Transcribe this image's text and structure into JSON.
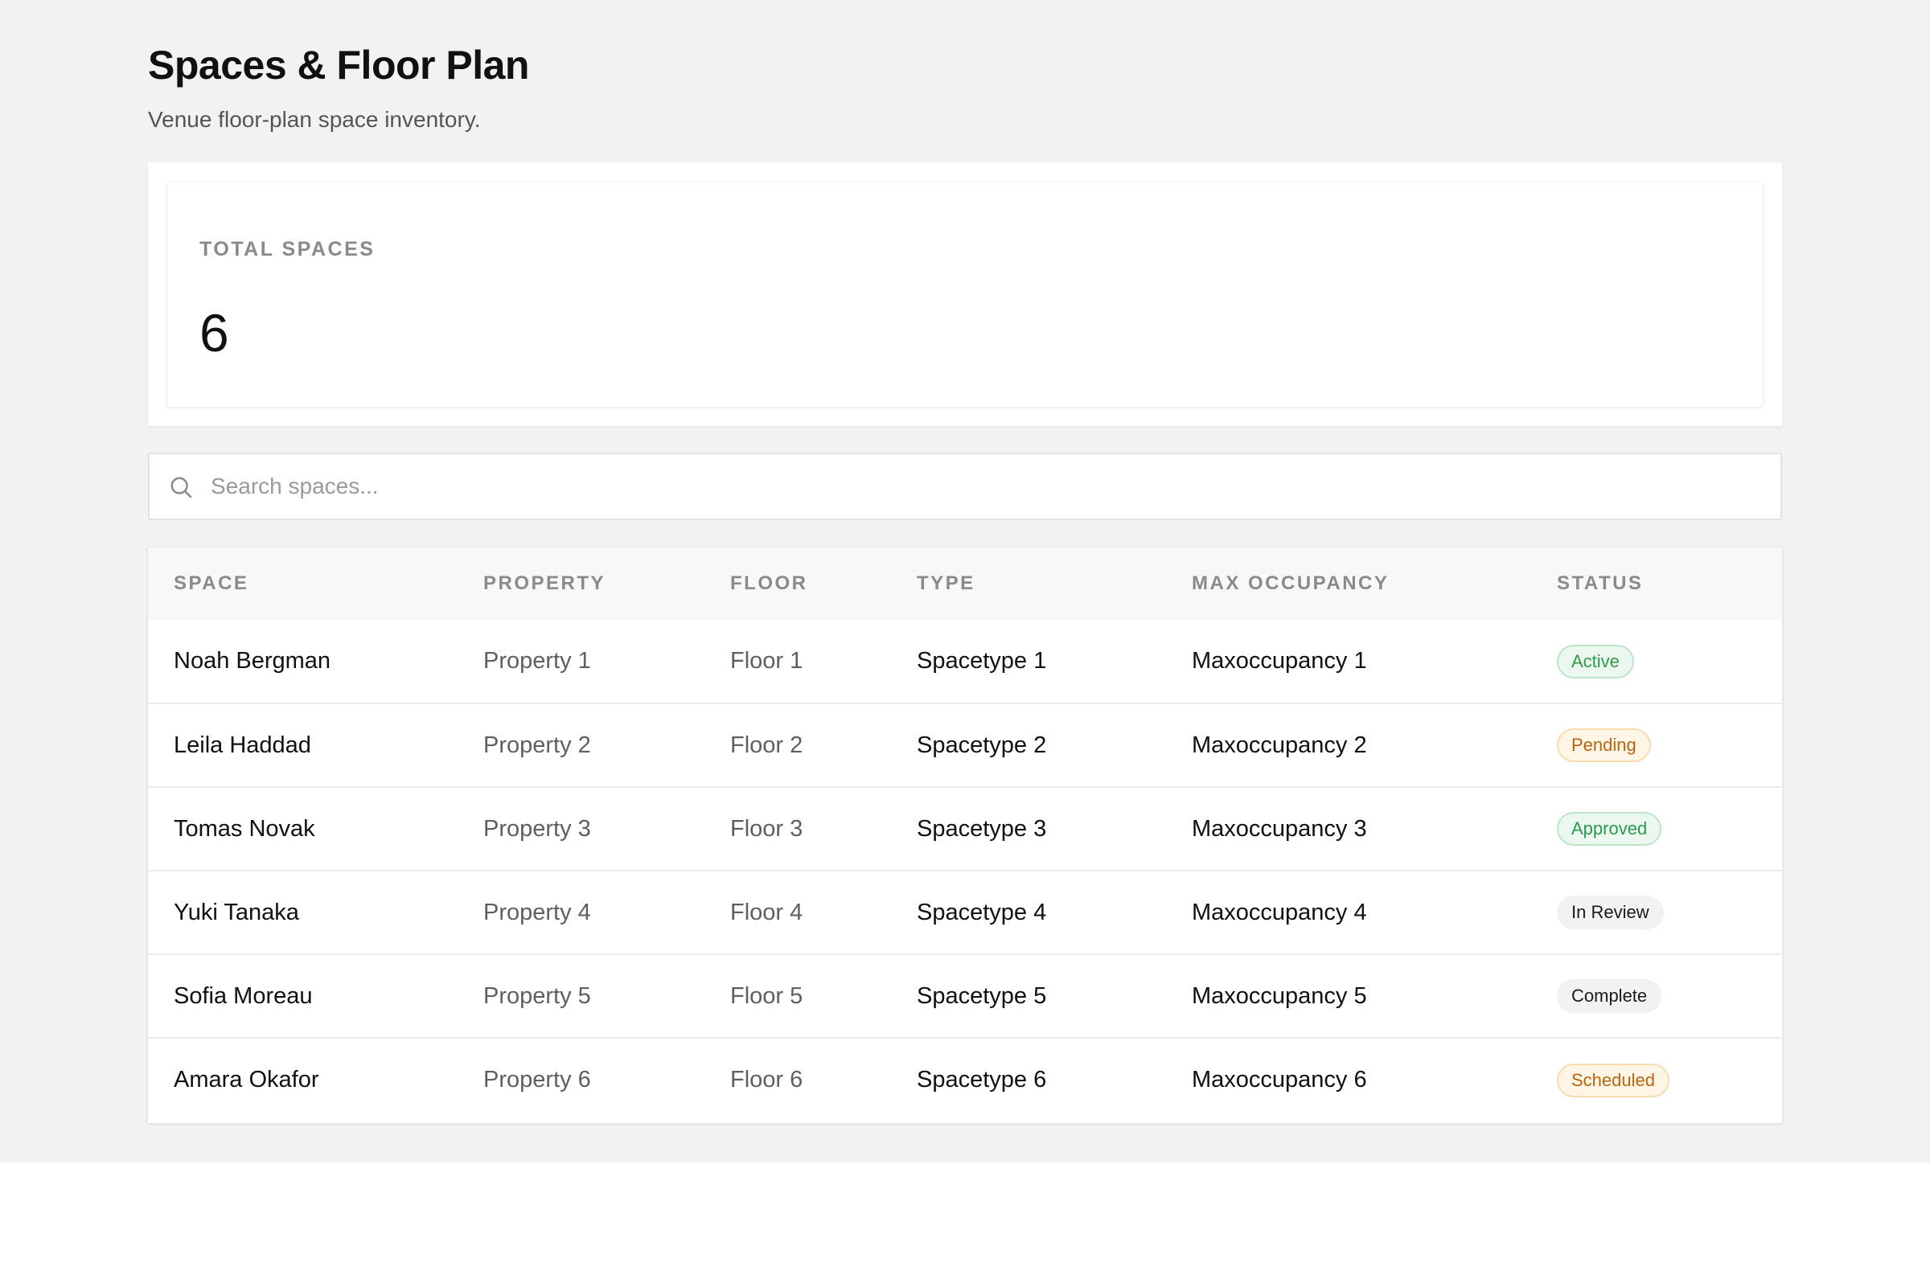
{
  "header": {
    "title": "Spaces & Floor Plan",
    "subtitle": "Venue floor-plan space inventory."
  },
  "stats": {
    "total_label": "TOTAL SPACES",
    "total_value": "6"
  },
  "search": {
    "placeholder": "Search spaces...",
    "value": ""
  },
  "table": {
    "columns": [
      "SPACE",
      "PROPERTY",
      "FLOOR",
      "TYPE",
      "MAX OCCUPANCY",
      "STATUS"
    ],
    "rows": [
      {
        "space": "Noah Bergman",
        "property": "Property 1",
        "floor": "Floor 1",
        "type": "Spacetype 1",
        "max_occupancy": "Maxoccupancy 1",
        "status": "Active",
        "status_tone": "green"
      },
      {
        "space": "Leila Haddad",
        "property": "Property 2",
        "floor": "Floor 2",
        "type": "Spacetype 2",
        "max_occupancy": "Maxoccupancy 2",
        "status": "Pending",
        "status_tone": "orange"
      },
      {
        "space": "Tomas Novak",
        "property": "Property 3",
        "floor": "Floor 3",
        "type": "Spacetype 3",
        "max_occupancy": "Maxoccupancy 3",
        "status": "Approved",
        "status_tone": "green"
      },
      {
        "space": "Yuki Tanaka",
        "property": "Property 4",
        "floor": "Floor 4",
        "type": "Spacetype 4",
        "max_occupancy": "Maxoccupancy 4",
        "status": "In Review",
        "status_tone": "gray"
      },
      {
        "space": "Sofia Moreau",
        "property": "Property 5",
        "floor": "Floor 5",
        "type": "Spacetype 5",
        "max_occupancy": "Maxoccupancy 5",
        "status": "Complete",
        "status_tone": "gray"
      },
      {
        "space": "Amara Okafor",
        "property": "Property 6",
        "floor": "Floor 6",
        "type": "Spacetype 6",
        "max_occupancy": "Maxoccupancy 6",
        "status": "Scheduled",
        "status_tone": "orange"
      }
    ]
  },
  "icons": {
    "search": "search-icon"
  },
  "colors": {
    "page_background": "#f2f2f2",
    "badge_green": "#2b9a4c",
    "badge_orange": "#b8650d",
    "badge_gray": "#1a1a1a"
  }
}
